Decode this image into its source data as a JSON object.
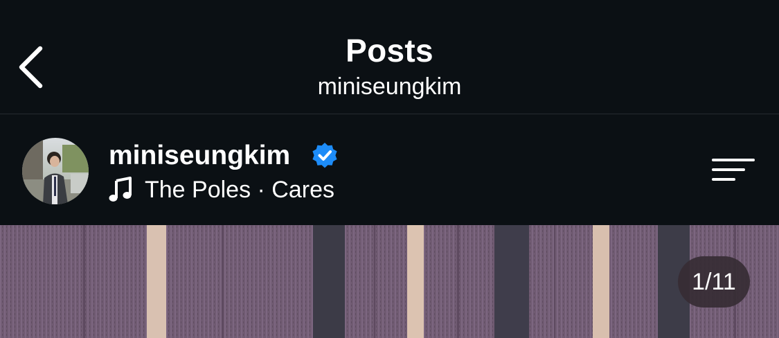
{
  "header": {
    "title": "Posts",
    "subtitle": "miniseungkim",
    "back_icon": "chevron-left-icon"
  },
  "post": {
    "username": "miniseungkim",
    "verified": true,
    "verified_color": "#1d8cf8",
    "music_icon": "music-note-icon",
    "music_label": "The Poles · Cares",
    "more_icon": "menu-lines-icon",
    "media_counter": "1/11"
  },
  "colors": {
    "background": "#0b1014",
    "text": "#ffffff",
    "image_base": "#6f5a72"
  }
}
